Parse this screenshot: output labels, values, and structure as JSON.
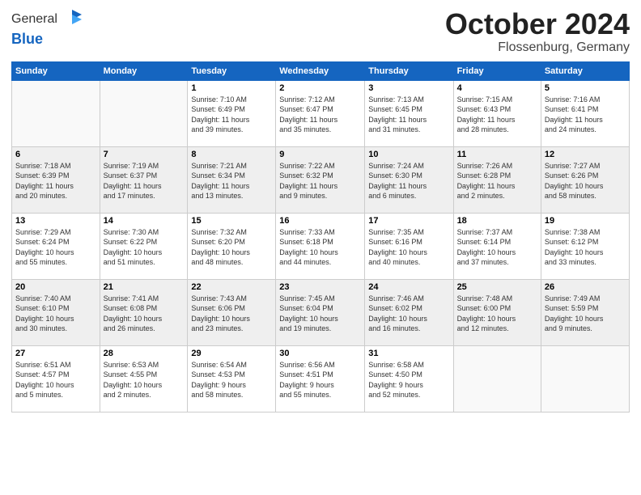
{
  "header": {
    "logo_general": "General",
    "logo_blue": "Blue",
    "title": "October 2024",
    "location": "Flossenburg, Germany"
  },
  "weekdays": [
    "Sunday",
    "Monday",
    "Tuesday",
    "Wednesday",
    "Thursday",
    "Friday",
    "Saturday"
  ],
  "weeks": [
    [
      {
        "day": "",
        "info": ""
      },
      {
        "day": "",
        "info": ""
      },
      {
        "day": "1",
        "info": "Sunrise: 7:10 AM\nSunset: 6:49 PM\nDaylight: 11 hours\nand 39 minutes."
      },
      {
        "day": "2",
        "info": "Sunrise: 7:12 AM\nSunset: 6:47 PM\nDaylight: 11 hours\nand 35 minutes."
      },
      {
        "day": "3",
        "info": "Sunrise: 7:13 AM\nSunset: 6:45 PM\nDaylight: 11 hours\nand 31 minutes."
      },
      {
        "day": "4",
        "info": "Sunrise: 7:15 AM\nSunset: 6:43 PM\nDaylight: 11 hours\nand 28 minutes."
      },
      {
        "day": "5",
        "info": "Sunrise: 7:16 AM\nSunset: 6:41 PM\nDaylight: 11 hours\nand 24 minutes."
      }
    ],
    [
      {
        "day": "6",
        "info": "Sunrise: 7:18 AM\nSunset: 6:39 PM\nDaylight: 11 hours\nand 20 minutes."
      },
      {
        "day": "7",
        "info": "Sunrise: 7:19 AM\nSunset: 6:37 PM\nDaylight: 11 hours\nand 17 minutes."
      },
      {
        "day": "8",
        "info": "Sunrise: 7:21 AM\nSunset: 6:34 PM\nDaylight: 11 hours\nand 13 minutes."
      },
      {
        "day": "9",
        "info": "Sunrise: 7:22 AM\nSunset: 6:32 PM\nDaylight: 11 hours\nand 9 minutes."
      },
      {
        "day": "10",
        "info": "Sunrise: 7:24 AM\nSunset: 6:30 PM\nDaylight: 11 hours\nand 6 minutes."
      },
      {
        "day": "11",
        "info": "Sunrise: 7:26 AM\nSunset: 6:28 PM\nDaylight: 11 hours\nand 2 minutes."
      },
      {
        "day": "12",
        "info": "Sunrise: 7:27 AM\nSunset: 6:26 PM\nDaylight: 10 hours\nand 58 minutes."
      }
    ],
    [
      {
        "day": "13",
        "info": "Sunrise: 7:29 AM\nSunset: 6:24 PM\nDaylight: 10 hours\nand 55 minutes."
      },
      {
        "day": "14",
        "info": "Sunrise: 7:30 AM\nSunset: 6:22 PM\nDaylight: 10 hours\nand 51 minutes."
      },
      {
        "day": "15",
        "info": "Sunrise: 7:32 AM\nSunset: 6:20 PM\nDaylight: 10 hours\nand 48 minutes."
      },
      {
        "day": "16",
        "info": "Sunrise: 7:33 AM\nSunset: 6:18 PM\nDaylight: 10 hours\nand 44 minutes."
      },
      {
        "day": "17",
        "info": "Sunrise: 7:35 AM\nSunset: 6:16 PM\nDaylight: 10 hours\nand 40 minutes."
      },
      {
        "day": "18",
        "info": "Sunrise: 7:37 AM\nSunset: 6:14 PM\nDaylight: 10 hours\nand 37 minutes."
      },
      {
        "day": "19",
        "info": "Sunrise: 7:38 AM\nSunset: 6:12 PM\nDaylight: 10 hours\nand 33 minutes."
      }
    ],
    [
      {
        "day": "20",
        "info": "Sunrise: 7:40 AM\nSunset: 6:10 PM\nDaylight: 10 hours\nand 30 minutes."
      },
      {
        "day": "21",
        "info": "Sunrise: 7:41 AM\nSunset: 6:08 PM\nDaylight: 10 hours\nand 26 minutes."
      },
      {
        "day": "22",
        "info": "Sunrise: 7:43 AM\nSunset: 6:06 PM\nDaylight: 10 hours\nand 23 minutes."
      },
      {
        "day": "23",
        "info": "Sunrise: 7:45 AM\nSunset: 6:04 PM\nDaylight: 10 hours\nand 19 minutes."
      },
      {
        "day": "24",
        "info": "Sunrise: 7:46 AM\nSunset: 6:02 PM\nDaylight: 10 hours\nand 16 minutes."
      },
      {
        "day": "25",
        "info": "Sunrise: 7:48 AM\nSunset: 6:00 PM\nDaylight: 10 hours\nand 12 minutes."
      },
      {
        "day": "26",
        "info": "Sunrise: 7:49 AM\nSunset: 5:59 PM\nDaylight: 10 hours\nand 9 minutes."
      }
    ],
    [
      {
        "day": "27",
        "info": "Sunrise: 6:51 AM\nSunset: 4:57 PM\nDaylight: 10 hours\nand 5 minutes."
      },
      {
        "day": "28",
        "info": "Sunrise: 6:53 AM\nSunset: 4:55 PM\nDaylight: 10 hours\nand 2 minutes."
      },
      {
        "day": "29",
        "info": "Sunrise: 6:54 AM\nSunset: 4:53 PM\nDaylight: 9 hours\nand 58 minutes."
      },
      {
        "day": "30",
        "info": "Sunrise: 6:56 AM\nSunset: 4:51 PM\nDaylight: 9 hours\nand 55 minutes."
      },
      {
        "day": "31",
        "info": "Sunrise: 6:58 AM\nSunset: 4:50 PM\nDaylight: 9 hours\nand 52 minutes."
      },
      {
        "day": "",
        "info": ""
      },
      {
        "day": "",
        "info": ""
      }
    ]
  ]
}
